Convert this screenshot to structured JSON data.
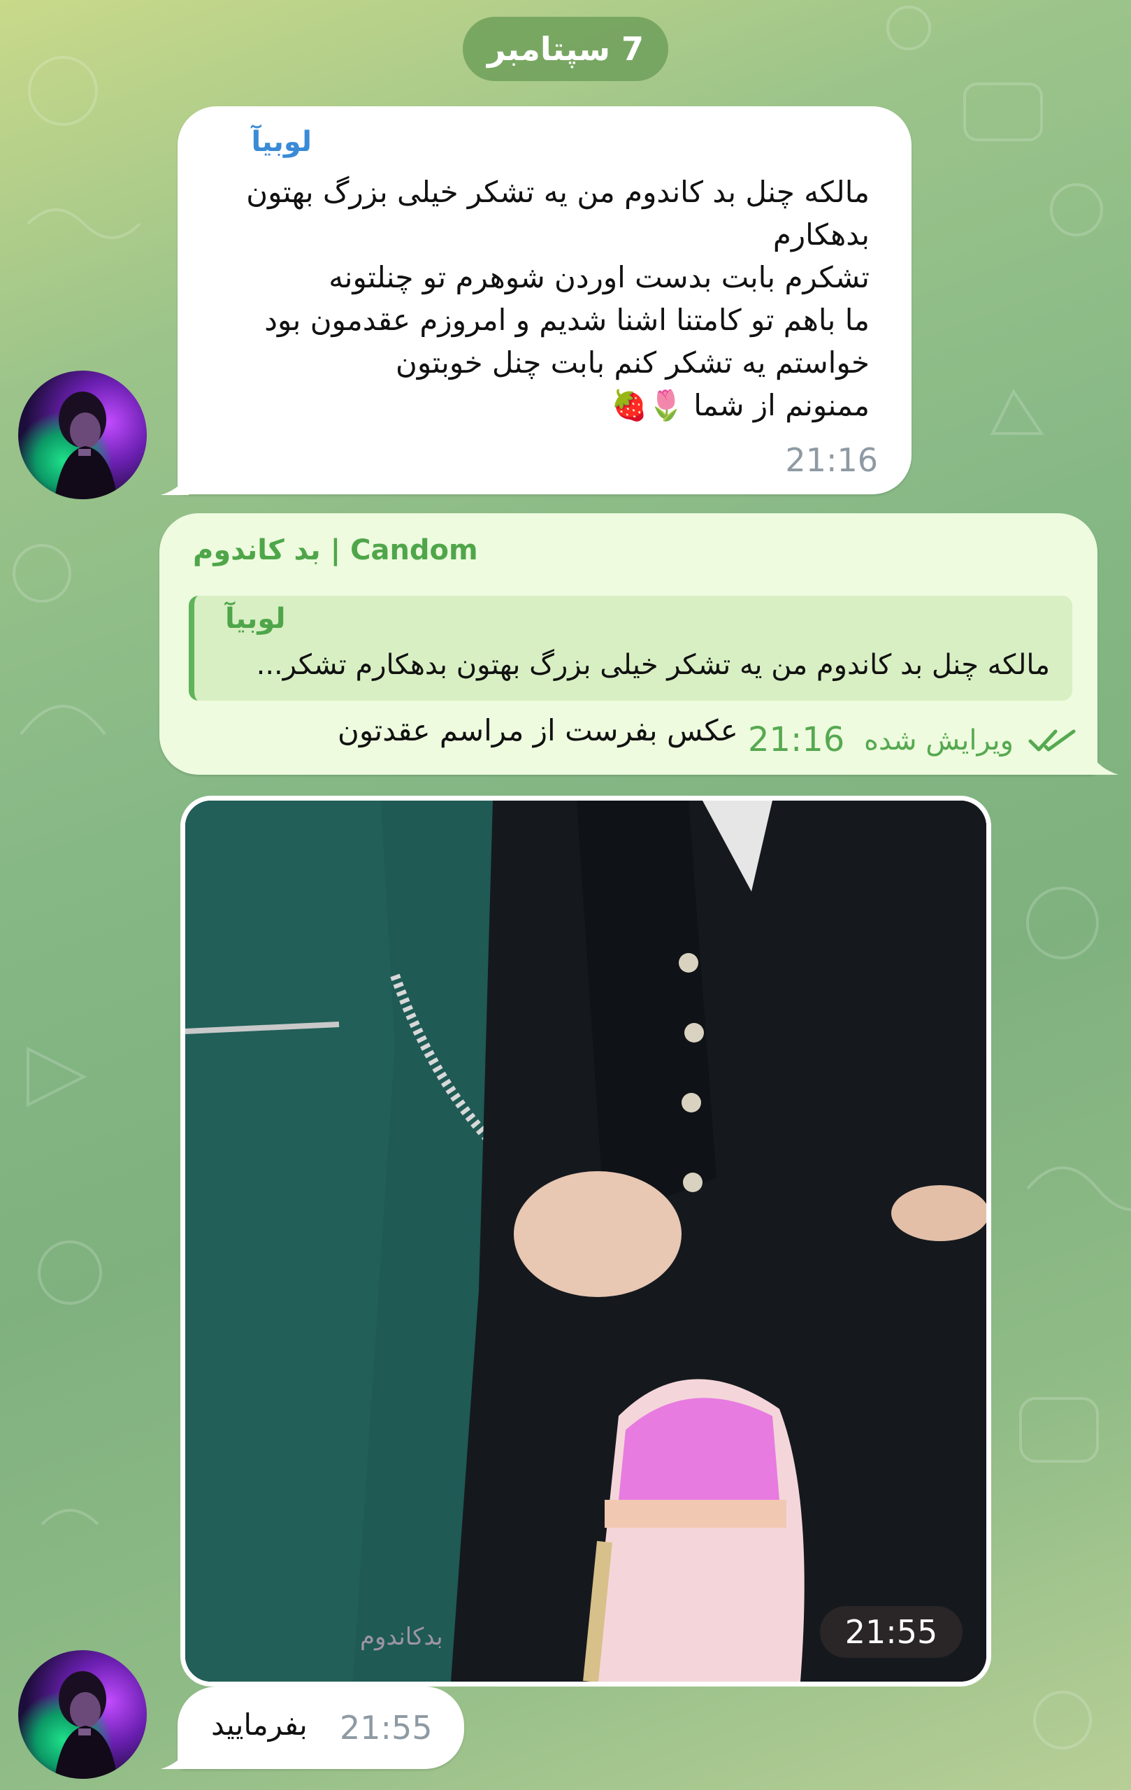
{
  "date_header": "7 سپتامبر",
  "incoming_message": {
    "sender": "لوبیآ",
    "lines": [
      "مالکه چنل بد کاندوم من یه تشکر خیلی بزرگ بهتون",
      "بدهکارم",
      "تشکرم بابت بدست اوردن شوهرم تو چنلتونه",
      "ما باهم تو کامتنا اشنا شدیم و امروزم عقدمون بود",
      "خواستم یه تشکر کنم بابت چنل خوبتون",
      "ممنونم از شما 🌷🍓"
    ],
    "time": "21:16"
  },
  "outgoing_message": {
    "sender": "بد کاندوم | Candom",
    "reply_to_sender": "لوبیآ",
    "reply_to_text": "مالکه چنل بد کاندوم من یه تشکر خیلی بزرگ بهتون بدهکارم تشکر...",
    "text": "عکس بفرست از مراسم عقدتون",
    "edited_label": "ویرایش شده",
    "time": "21:16",
    "read_status_icon": "double-check-icon"
  },
  "photo_message": {
    "watermark": "بدکاندوم",
    "time": "21:55"
  },
  "last_message": {
    "text": "بفرمایید",
    "time": "21:55"
  },
  "colors": {
    "incoming_sender": "#3a8bd6",
    "outgoing_sender": "#4fa64a",
    "outgoing_time": "#56a950",
    "bubble_incoming": "#ffffff",
    "bubble_outgoing": "#eefbdf"
  }
}
